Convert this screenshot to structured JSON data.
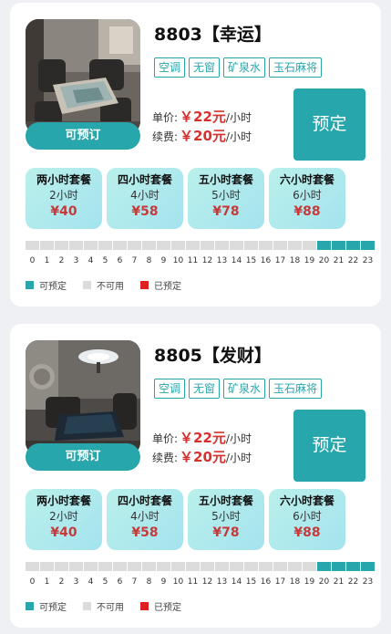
{
  "colors": {
    "accent": "#27a6ac",
    "unavailable": "#dcdcdc",
    "booked": "#e02020",
    "price": "#d8312d"
  },
  "rooms": [
    {
      "name": "8803【幸运】",
      "photo_icon": "room-photo-icon",
      "status": "可预订",
      "tags": [
        "空调",
        "无窗",
        "矿泉水",
        "玉石麻将"
      ],
      "unit_price_label": "单价:",
      "unit_price_amount": "￥22元",
      "unit_price_unit": "/小时",
      "renew_price_label": "续费:",
      "renew_price_amount": "￥20元",
      "renew_price_unit": "/小时",
      "book_label": "预定",
      "packages": [
        {
          "name": "两小时套餐",
          "hours": "2小时",
          "price": "¥40"
        },
        {
          "name": "四小时套餐",
          "hours": "4小时",
          "price": "¥58"
        },
        {
          "name": "五小时套餐",
          "hours": "5小时",
          "price": "¥78"
        },
        {
          "name": "六小时套餐",
          "hours": "6小时",
          "price": "¥88"
        }
      ],
      "slots": [
        "u",
        "u",
        "u",
        "u",
        "u",
        "u",
        "u",
        "u",
        "u",
        "u",
        "u",
        "u",
        "u",
        "u",
        "u",
        "u",
        "u",
        "u",
        "u",
        "u",
        "a",
        "a",
        "a",
        "a"
      ],
      "hour_labels": [
        "0",
        "1",
        "2",
        "3",
        "4",
        "5",
        "6",
        "7",
        "8",
        "9",
        "10",
        "11",
        "12",
        "13",
        "14",
        "15",
        "16",
        "17",
        "18",
        "19",
        "20",
        "21",
        "22",
        "23"
      ]
    },
    {
      "name": "8805【发财】",
      "photo_icon": "room-photo-icon",
      "status": "可预订",
      "tags": [
        "空调",
        "无窗",
        "矿泉水",
        "玉石麻将"
      ],
      "unit_price_label": "单价:",
      "unit_price_amount": "￥22元",
      "unit_price_unit": "/小时",
      "renew_price_label": "续费:",
      "renew_price_amount": "￥20元",
      "renew_price_unit": "/小时",
      "book_label": "预定",
      "packages": [
        {
          "name": "两小时套餐",
          "hours": "2小时",
          "price": "¥40"
        },
        {
          "name": "四小时套餐",
          "hours": "4小时",
          "price": "¥58"
        },
        {
          "name": "五小时套餐",
          "hours": "5小时",
          "price": "¥78"
        },
        {
          "name": "六小时套餐",
          "hours": "6小时",
          "price": "¥88"
        }
      ],
      "slots": [
        "u",
        "u",
        "u",
        "u",
        "u",
        "u",
        "u",
        "u",
        "u",
        "u",
        "u",
        "u",
        "u",
        "u",
        "u",
        "u",
        "u",
        "u",
        "u",
        "u",
        "a",
        "a",
        "a",
        "a"
      ],
      "hour_labels": [
        "0",
        "1",
        "2",
        "3",
        "4",
        "5",
        "6",
        "7",
        "8",
        "9",
        "10",
        "11",
        "12",
        "13",
        "14",
        "15",
        "16",
        "17",
        "18",
        "19",
        "20",
        "21",
        "22",
        "23"
      ]
    }
  ],
  "legend": {
    "available": "可预定",
    "unavailable": "不可用",
    "booked": "已预定"
  }
}
